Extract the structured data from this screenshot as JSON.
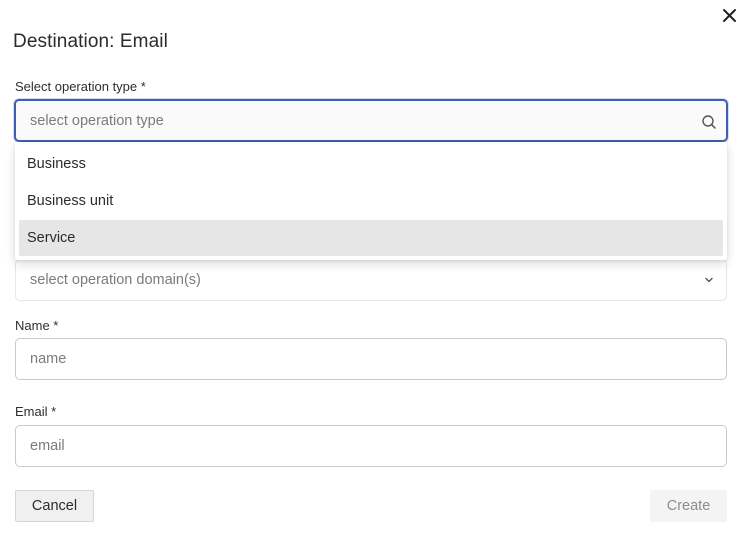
{
  "dialog": {
    "title": "Destination: Email",
    "close_icon": "close-icon"
  },
  "form": {
    "operation_type": {
      "label": "Select operation type *",
      "placeholder": "select operation type",
      "icon": "search-icon",
      "options": [
        "Business",
        "Business unit",
        "Service"
      ],
      "highlighted_option": "Service"
    },
    "operation_domain": {
      "placeholder": "select operation domain(s)",
      "icon": "chevron-down-icon"
    },
    "name": {
      "label": "Name *",
      "placeholder": "name"
    },
    "email": {
      "label": "Email *",
      "placeholder": "email"
    }
  },
  "actions": {
    "cancel_label": "Cancel",
    "create_label": "Create",
    "create_enabled": false
  },
  "colors": {
    "focus_border": "#3f5fb0",
    "highlight_bg": "#e6e6e7",
    "disabled_text": "#8c8c8c"
  }
}
